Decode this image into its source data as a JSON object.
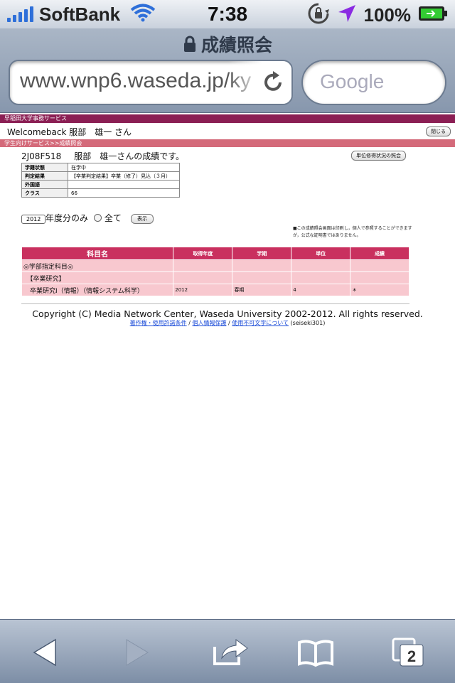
{
  "status": {
    "carrier": "SoftBank",
    "time": "7:38",
    "battery": "100%"
  },
  "browser": {
    "title": "成績照会",
    "url": "www.wnp6.waseda.jp/ky",
    "search_placeholder": "Google"
  },
  "page": {
    "site_name": "早稲田大学事務サービス",
    "welcome": "Welcomeback 服部　雄一 さん",
    "close_label": "閉じる",
    "breadcrumb": "学生向けサービス>>成績照会",
    "student_id": "2J08F518",
    "student_line": "服部　雄一さんの成績です。",
    "status_button": "単位修得状況の照会",
    "info": [
      {
        "key": "学籍状態",
        "value": "在学中"
      },
      {
        "key": "判定結果",
        "value": "【卒業判定結果】卒業（修了）見込（３月）"
      },
      {
        "key": "外国語",
        "value": ""
      },
      {
        "key": "クラス",
        "value": "66"
      }
    ],
    "year_value": "2012",
    "year_only_label": "年度分のみ",
    "all_label": "全て",
    "show_button": "表示",
    "note": "■この成績照会画面は印刷し，個人で参照することができますが，公式な証明書ではありません。",
    "grades_headers": [
      "科目名",
      "取得年度",
      "学期",
      "単位",
      "成績"
    ],
    "grades_rows": [
      [
        "◎学部指定科目◎",
        "",
        "",
        "",
        ""
      ],
      [
        "　【卒業研究】",
        "",
        "",
        "",
        ""
      ],
      [
        "　卒業研究Ⅰ（情報）（情報システム科学）",
        "2012",
        "春期",
        "4",
        "＊"
      ]
    ],
    "copyright": "Copyright (C) Media Network Center, Waseda University 2002-2012. All rights reserved.",
    "links": [
      "著作権・使用許諾条件",
      "個人情報保護",
      "使用不可文字について"
    ],
    "link_sep": " / ",
    "page_code": " (seiseki301)"
  },
  "toolbar": {
    "tabs_count": "2"
  }
}
